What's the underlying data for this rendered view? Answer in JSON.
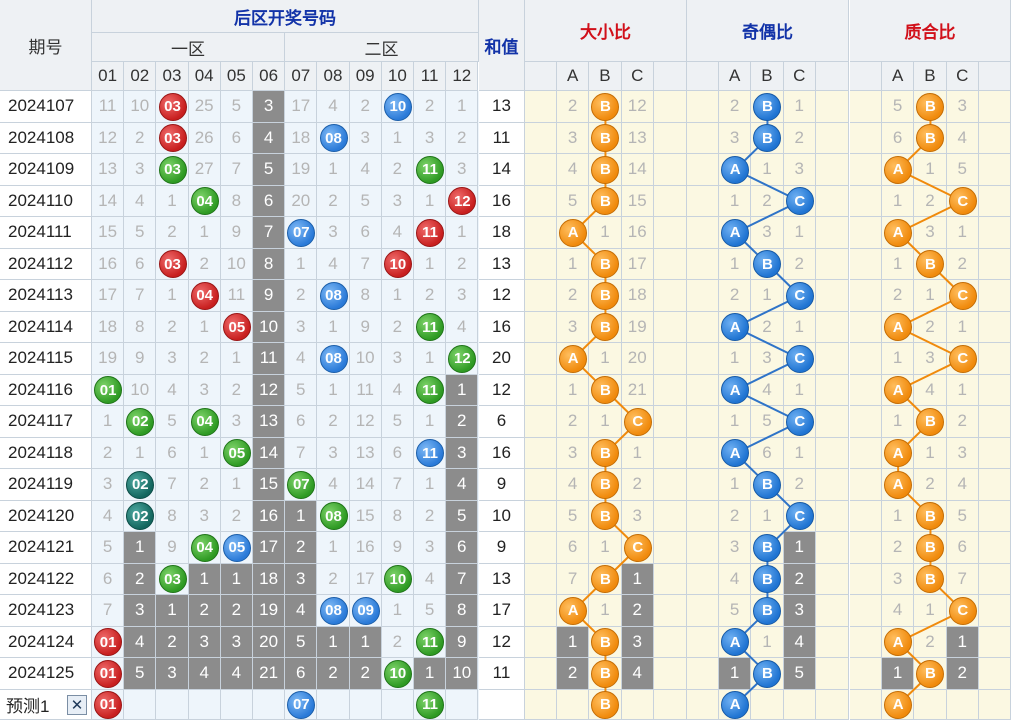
{
  "headers": {
    "period": "期号",
    "back_zone": "后区开奖号码",
    "zone1": "一区",
    "zone2": "二区",
    "sum": "和值",
    "size_ratio": "大小比",
    "odd_even_ratio": "奇偶比",
    "prime_ratio": "质合比"
  },
  "number_columns": [
    "01",
    "02",
    "03",
    "04",
    "05",
    "06",
    "07",
    "08",
    "09",
    "10",
    "11",
    "12"
  ],
  "abc": [
    "A",
    "B",
    "C"
  ],
  "periods": [
    "2024107",
    "2024108",
    "2024109",
    "2024110",
    "2024111",
    "2024112",
    "2024113",
    "2024114",
    "2024115",
    "2024116",
    "2024117",
    "2024118",
    "2024119",
    "2024120",
    "2024121",
    "2024122",
    "2024123",
    "2024124",
    "2024125"
  ],
  "sums": [
    "13",
    "11",
    "14",
    "16",
    "18",
    "13",
    "12",
    "16",
    "20",
    "12",
    "6",
    "16",
    "9",
    "10",
    "9",
    "13",
    "17",
    "12",
    "11"
  ],
  "grid": [
    [
      "11",
      "10",
      "03",
      "25",
      "5",
      "3",
      "17",
      "4",
      "2",
      "10",
      "2",
      "1"
    ],
    [
      "12",
      "2",
      "03",
      "26",
      "6",
      "4",
      "18",
      "08",
      "3",
      "1",
      "3",
      "2"
    ],
    [
      "13",
      "3",
      "03",
      "27",
      "7",
      "5",
      "19",
      "1",
      "4",
      "2",
      "11",
      "3"
    ],
    [
      "14",
      "4",
      "1",
      "04",
      "8",
      "6",
      "20",
      "2",
      "5",
      "3",
      "1",
      "12"
    ],
    [
      "15",
      "5",
      "2",
      "1",
      "9",
      "7",
      "07",
      "3",
      "6",
      "4",
      "11",
      "1"
    ],
    [
      "16",
      "6",
      "03",
      "2",
      "10",
      "8",
      "1",
      "4",
      "7",
      "10",
      "1",
      "2"
    ],
    [
      "17",
      "7",
      "1",
      "04",
      "11",
      "9",
      "2",
      "08",
      "8",
      "1",
      "2",
      "3"
    ],
    [
      "18",
      "8",
      "2",
      "1",
      "05",
      "10",
      "3",
      "1",
      "9",
      "2",
      "11",
      "4"
    ],
    [
      "19",
      "9",
      "3",
      "2",
      "1",
      "11",
      "4",
      "08",
      "10",
      "3",
      "1",
      "12"
    ],
    [
      "01",
      "10",
      "4",
      "3",
      "2",
      "12",
      "5",
      "1",
      "11",
      "4",
      "11",
      "1"
    ],
    [
      "1",
      "02",
      "5",
      "04",
      "3",
      "13",
      "6",
      "2",
      "12",
      "5",
      "1",
      "2"
    ],
    [
      "2",
      "1",
      "6",
      "1",
      "05",
      "14",
      "7",
      "3",
      "13",
      "6",
      "11",
      "3"
    ],
    [
      "3",
      "02",
      "7",
      "2",
      "1",
      "15",
      "07",
      "4",
      "14",
      "7",
      "1",
      "4"
    ],
    [
      "4",
      "02",
      "8",
      "3",
      "2",
      "16",
      "1",
      "08",
      "15",
      "8",
      "2",
      "5"
    ],
    [
      "5",
      "1",
      "9",
      "04",
      "05",
      "17",
      "2",
      "1",
      "16",
      "9",
      "3",
      "6"
    ],
    [
      "6",
      "2",
      "03",
      "1",
      "1",
      "18",
      "3",
      "2",
      "17",
      "10",
      "4",
      "7"
    ],
    [
      "7",
      "3",
      "1",
      "2",
      "2",
      "19",
      "4",
      "08",
      "09",
      "1",
      "5",
      "8"
    ],
    [
      "01",
      "4",
      "2",
      "3",
      "3",
      "20",
      "5",
      "1",
      "1",
      "2",
      "11",
      "9"
    ],
    [
      "01",
      "5",
      "3",
      "4",
      "4",
      "21",
      "6",
      "2",
      "2",
      "10",
      "1",
      "10"
    ]
  ],
  "ball_colors": [
    {
      "r": 0,
      "c": 2,
      "k": "red"
    },
    {
      "r": 0,
      "c": 9,
      "k": "blue"
    },
    {
      "r": 1,
      "c": 2,
      "k": "red"
    },
    {
      "r": 1,
      "c": 7,
      "k": "blue"
    },
    {
      "r": 2,
      "c": 2,
      "k": "green"
    },
    {
      "r": 2,
      "c": 10,
      "k": "green"
    },
    {
      "r": 3,
      "c": 3,
      "k": "green"
    },
    {
      "r": 3,
      "c": 11,
      "k": "red"
    },
    {
      "r": 4,
      "c": 6,
      "k": "blue"
    },
    {
      "r": 4,
      "c": 10,
      "k": "red"
    },
    {
      "r": 5,
      "c": 2,
      "k": "red"
    },
    {
      "r": 5,
      "c": 9,
      "k": "red"
    },
    {
      "r": 6,
      "c": 3,
      "k": "red"
    },
    {
      "r": 6,
      "c": 7,
      "k": "blue"
    },
    {
      "r": 7,
      "c": 4,
      "k": "red"
    },
    {
      "r": 7,
      "c": 10,
      "k": "green"
    },
    {
      "r": 8,
      "c": 7,
      "k": "blue"
    },
    {
      "r": 8,
      "c": 11,
      "k": "green"
    },
    {
      "r": 9,
      "c": 0,
      "k": "green"
    },
    {
      "r": 9,
      "c": 10,
      "k": "green"
    },
    {
      "r": 10,
      "c": 1,
      "k": "green"
    },
    {
      "r": 10,
      "c": 3,
      "k": "green"
    },
    {
      "r": 11,
      "c": 4,
      "k": "green"
    },
    {
      "r": 11,
      "c": 10,
      "k": "blue"
    },
    {
      "r": 12,
      "c": 1,
      "k": "teal"
    },
    {
      "r": 12,
      "c": 6,
      "k": "green"
    },
    {
      "r": 13,
      "c": 1,
      "k": "teal"
    },
    {
      "r": 13,
      "c": 7,
      "k": "green"
    },
    {
      "r": 14,
      "c": 3,
      "k": "green"
    },
    {
      "r": 14,
      "c": 4,
      "k": "blue"
    },
    {
      "r": 15,
      "c": 2,
      "k": "green"
    },
    {
      "r": 15,
      "c": 9,
      "k": "green"
    },
    {
      "r": 16,
      "c": 7,
      "k": "blue"
    },
    {
      "r": 16,
      "c": 8,
      "k": "blue"
    },
    {
      "r": 17,
      "c": 0,
      "k": "red"
    },
    {
      "r": 17,
      "c": 10,
      "k": "green"
    },
    {
      "r": 18,
      "c": 0,
      "k": "red"
    },
    {
      "r": 18,
      "c": 9,
      "k": "green"
    }
  ],
  "grey_cells": [
    [
      0,
      5
    ],
    [
      1,
      5
    ],
    [
      2,
      5
    ],
    [
      3,
      5
    ],
    [
      4,
      5
    ],
    [
      5,
      5
    ],
    [
      6,
      5
    ],
    [
      7,
      5
    ],
    [
      8,
      5
    ],
    [
      9,
      5
    ],
    [
      10,
      5
    ],
    [
      11,
      5
    ],
    [
      12,
      5
    ],
    [
      13,
      5
    ],
    [
      14,
      5
    ],
    [
      15,
      5
    ],
    [
      16,
      5
    ],
    [
      17,
      5
    ],
    [
      18,
      5
    ],
    [
      9,
      11
    ],
    [
      10,
      11
    ],
    [
      11,
      11
    ],
    [
      12,
      11
    ],
    [
      13,
      11
    ],
    [
      14,
      11
    ],
    [
      15,
      11
    ],
    [
      16,
      11
    ],
    [
      17,
      11
    ],
    [
      18,
      11
    ],
    [
      13,
      6
    ],
    [
      14,
      6
    ],
    [
      15,
      6
    ],
    [
      16,
      6
    ],
    [
      17,
      6
    ],
    [
      18,
      6
    ],
    [
      14,
      1
    ],
    [
      15,
      1
    ],
    [
      16,
      1
    ],
    [
      17,
      1
    ],
    [
      18,
      1
    ],
    [
      15,
      3
    ],
    [
      16,
      3
    ],
    [
      17,
      3
    ],
    [
      18,
      3
    ],
    [
      15,
      4
    ],
    [
      16,
      4
    ],
    [
      17,
      4
    ],
    [
      18,
      4
    ],
    [
      16,
      2
    ],
    [
      17,
      2
    ],
    [
      18,
      2
    ],
    [
      17,
      7
    ],
    [
      18,
      7
    ],
    [
      17,
      8
    ],
    [
      18,
      8
    ],
    [
      18,
      10
    ]
  ],
  "size": [
    [
      "2",
      "B",
      "12"
    ],
    [
      "3",
      "B",
      "13"
    ],
    [
      "4",
      "B",
      "14"
    ],
    [
      "5",
      "B",
      "15"
    ],
    [
      "A",
      "1",
      "16"
    ],
    [
      "1",
      "B",
      "17"
    ],
    [
      "2",
      "B",
      "18"
    ],
    [
      "3",
      "B",
      "19"
    ],
    [
      "A",
      "1",
      "20"
    ],
    [
      "1",
      "B",
      "21"
    ],
    [
      "2",
      "1",
      "C"
    ],
    [
      "3",
      "B",
      "1"
    ],
    [
      "4",
      "B",
      "2"
    ],
    [
      "5",
      "B",
      "3"
    ],
    [
      "6",
      "1",
      "C"
    ],
    [
      "7",
      "B",
      "1"
    ],
    [
      "A",
      "1",
      "2"
    ],
    [
      "1",
      "B",
      "3"
    ],
    [
      "2",
      "B",
      "4"
    ]
  ],
  "size_ball": [
    1,
    1,
    1,
    1,
    0,
    1,
    1,
    1,
    0,
    1,
    2,
    1,
    1,
    1,
    2,
    1,
    0,
    1,
    1
  ],
  "size_grey": [
    [
      14,
      2
    ],
    [
      15,
      2
    ],
    [
      16,
      2
    ],
    [
      17,
      0
    ],
    [
      17,
      2
    ],
    [
      18,
      0
    ],
    [
      18,
      2
    ]
  ],
  "odd": [
    [
      "2",
      "B",
      "1"
    ],
    [
      "3",
      "B",
      "2"
    ],
    [
      "A",
      "1",
      "3"
    ],
    [
      "1",
      "2",
      "C"
    ],
    [
      "A",
      "3",
      "1"
    ],
    [
      "1",
      "B",
      "2"
    ],
    [
      "2",
      "1",
      "C"
    ],
    [
      "A",
      "2",
      "1"
    ],
    [
      "1",
      "3",
      "C"
    ],
    [
      "A",
      "4",
      "1"
    ],
    [
      "1",
      "5",
      "C"
    ],
    [
      "A",
      "6",
      "1"
    ],
    [
      "1",
      "B",
      "2"
    ],
    [
      "2",
      "1",
      "C"
    ],
    [
      "3",
      "B",
      "1"
    ],
    [
      "4",
      "B",
      "2"
    ],
    [
      "5",
      "B",
      "3"
    ],
    [
      "A",
      "1",
      "4"
    ],
    [
      "1",
      "B",
      "5"
    ]
  ],
  "odd_ball": [
    1,
    1,
    0,
    2,
    0,
    1,
    2,
    0,
    2,
    0,
    2,
    0,
    1,
    2,
    1,
    1,
    1,
    0,
    1
  ],
  "odd_grey": [
    [
      14,
      2
    ],
    [
      15,
      2
    ],
    [
      16,
      2
    ],
    [
      17,
      2
    ],
    [
      18,
      0
    ],
    [
      18,
      2
    ]
  ],
  "prime": [
    [
      "5",
      "B",
      "3"
    ],
    [
      "6",
      "B",
      "4"
    ],
    [
      "A",
      "1",
      "5"
    ],
    [
      "1",
      "2",
      "C"
    ],
    [
      "A",
      "3",
      "1"
    ],
    [
      "1",
      "B",
      "2"
    ],
    [
      "2",
      "1",
      "C"
    ],
    [
      "A",
      "2",
      "1"
    ],
    [
      "1",
      "3",
      "C"
    ],
    [
      "A",
      "4",
      "1"
    ],
    [
      "1",
      "B",
      "2"
    ],
    [
      "A",
      "1",
      "3"
    ],
    [
      "A",
      "2",
      "4"
    ],
    [
      "1",
      "B",
      "5"
    ],
    [
      "2",
      "B",
      "6"
    ],
    [
      "3",
      "B",
      "7"
    ],
    [
      "4",
      "1",
      "C"
    ],
    [
      "A",
      "2",
      "1"
    ],
    [
      "1",
      "B",
      "2"
    ]
  ],
  "prime_ball": [
    1,
    1,
    0,
    2,
    0,
    1,
    2,
    0,
    2,
    0,
    1,
    0,
    0,
    1,
    1,
    1,
    2,
    0,
    1
  ],
  "prime_grey": [
    [
      17,
      2
    ],
    [
      18,
      0
    ],
    [
      18,
      2
    ]
  ],
  "forecast": {
    "label": "预测1",
    "close": "✕",
    "numbers": [
      {
        "c": 0,
        "v": "01",
        "k": "red"
      },
      {
        "c": 6,
        "v": "07",
        "k": "blue"
      },
      {
        "c": 10,
        "v": "11",
        "k": "green"
      }
    ],
    "size": "B",
    "odd": "A",
    "prime": "A"
  }
}
